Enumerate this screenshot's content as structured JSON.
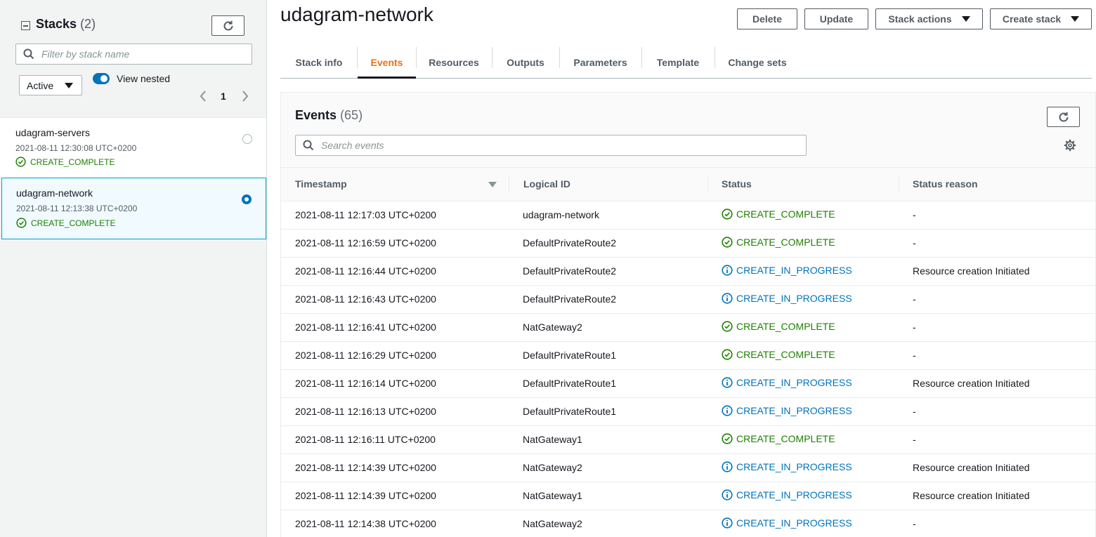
{
  "sidebar": {
    "title": "Stacks",
    "count": "(2)",
    "filter_placeholder": "Filter by stack name",
    "status_filter": "Active",
    "view_nested_label": "View nested",
    "page": "1",
    "stacks": [
      {
        "name": "udagram-servers",
        "date": "2021-08-11 12:30:08 UTC+0200",
        "status": "CREATE_COMPLETE",
        "selected": false
      },
      {
        "name": "udagram-network",
        "date": "2021-08-11 12:13:38 UTC+0200",
        "status": "CREATE_COMPLETE",
        "selected": true
      }
    ]
  },
  "header": {
    "title": "udagram-network",
    "buttons": {
      "delete": "Delete",
      "update": "Update",
      "stack_actions": "Stack actions",
      "create_stack": "Create stack"
    }
  },
  "tabs": [
    {
      "label": "Stack info",
      "active": false
    },
    {
      "label": "Events",
      "active": true
    },
    {
      "label": "Resources",
      "active": false
    },
    {
      "label": "Outputs",
      "active": false
    },
    {
      "label": "Parameters",
      "active": false
    },
    {
      "label": "Template",
      "active": false
    },
    {
      "label": "Change sets",
      "active": false
    }
  ],
  "events": {
    "title": "Events",
    "count": "(65)",
    "search_placeholder": "Search events",
    "columns": [
      "Timestamp",
      "Logical ID",
      "Status",
      "Status reason"
    ],
    "rows": [
      {
        "timestamp": "2021-08-11 12:17:03 UTC+0200",
        "logical_id": "udagram-network",
        "status": "CREATE_COMPLETE",
        "reason": "-"
      },
      {
        "timestamp": "2021-08-11 12:16:59 UTC+0200",
        "logical_id": "DefaultPrivateRoute2",
        "status": "CREATE_COMPLETE",
        "reason": "-"
      },
      {
        "timestamp": "2021-08-11 12:16:44 UTC+0200",
        "logical_id": "DefaultPrivateRoute2",
        "status": "CREATE_IN_PROGRESS",
        "reason": "Resource creation Initiated"
      },
      {
        "timestamp": "2021-08-11 12:16:43 UTC+0200",
        "logical_id": "DefaultPrivateRoute2",
        "status": "CREATE_IN_PROGRESS",
        "reason": "-"
      },
      {
        "timestamp": "2021-08-11 12:16:41 UTC+0200",
        "logical_id": "NatGateway2",
        "status": "CREATE_COMPLETE",
        "reason": "-"
      },
      {
        "timestamp": "2021-08-11 12:16:29 UTC+0200",
        "logical_id": "DefaultPrivateRoute1",
        "status": "CREATE_COMPLETE",
        "reason": "-"
      },
      {
        "timestamp": "2021-08-11 12:16:14 UTC+0200",
        "logical_id": "DefaultPrivateRoute1",
        "status": "CREATE_IN_PROGRESS",
        "reason": "Resource creation Initiated"
      },
      {
        "timestamp": "2021-08-11 12:16:13 UTC+0200",
        "logical_id": "DefaultPrivateRoute1",
        "status": "CREATE_IN_PROGRESS",
        "reason": "-"
      },
      {
        "timestamp": "2021-08-11 12:16:11 UTC+0200",
        "logical_id": "NatGateway1",
        "status": "CREATE_COMPLETE",
        "reason": "-"
      },
      {
        "timestamp": "2021-08-11 12:14:39 UTC+0200",
        "logical_id": "NatGateway2",
        "status": "CREATE_IN_PROGRESS",
        "reason": "Resource creation Initiated"
      },
      {
        "timestamp": "2021-08-11 12:14:39 UTC+0200",
        "logical_id": "NatGateway1",
        "status": "CREATE_IN_PROGRESS",
        "reason": "Resource creation Initiated"
      },
      {
        "timestamp": "2021-08-11 12:14:38 UTC+0200",
        "logical_id": "NatGateway2",
        "status": "CREATE_IN_PROGRESS",
        "reason": "-"
      }
    ]
  },
  "colors": {
    "complete": "#1d8102",
    "in_progress": "#0073bb",
    "active_tab": "#ec7211",
    "selected_bg": "#f1faff"
  },
  "icons": [
    "minus-square-icon",
    "refresh-icon",
    "search-icon",
    "chevron-left-icon",
    "chevron-right-icon",
    "check-circle-icon",
    "info-circle-icon",
    "gear-icon",
    "caret-down-icon",
    "sort-down-icon"
  ]
}
